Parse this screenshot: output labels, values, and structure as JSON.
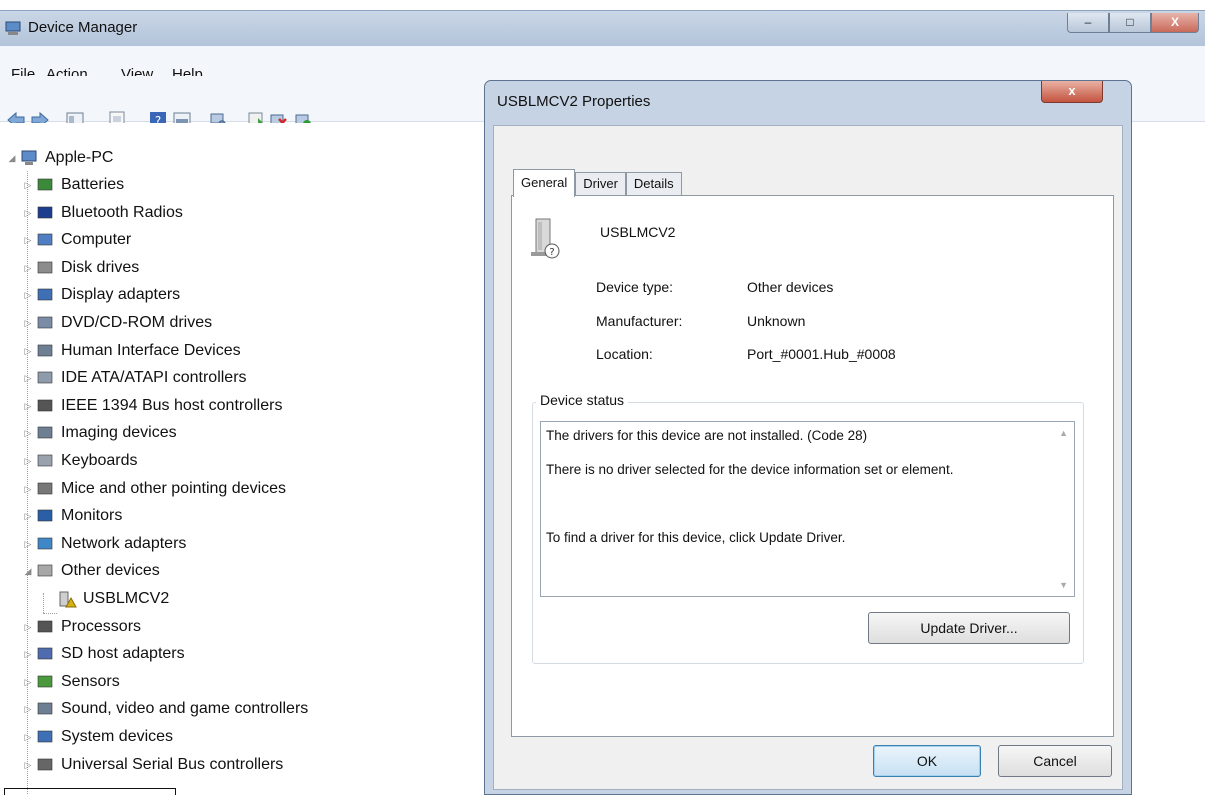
{
  "window": {
    "title": "Device Manager",
    "controls": {
      "minimize": "–",
      "maximize": "□",
      "close": "X"
    }
  },
  "menu": [
    "File",
    "Action",
    "View",
    "Help"
  ],
  "toolbar_icons": [
    "back-icon",
    "forward-icon",
    "properties-view-icon",
    "blank-page-icon",
    "help-icon",
    "view-icon",
    "scan-hardware-icon",
    "update-driver-icon",
    "uninstall-icon",
    "disable-icon"
  ],
  "tree": {
    "root": "Apple-PC",
    "categories": [
      {
        "label": "Batteries",
        "icon": "battery-icon",
        "expanded": false
      },
      {
        "label": "Bluetooth Radios",
        "icon": "bluetooth-icon",
        "expanded": false
      },
      {
        "label": "Computer",
        "icon": "computer-icon",
        "expanded": false
      },
      {
        "label": "Disk drives",
        "icon": "disk-drive-icon",
        "expanded": false
      },
      {
        "label": "Display adapters",
        "icon": "display-adapter-icon",
        "expanded": false
      },
      {
        "label": "DVD/CD-ROM drives",
        "icon": "dvd-drive-icon",
        "expanded": false
      },
      {
        "label": "Human Interface Devices",
        "icon": "hid-icon",
        "expanded": false
      },
      {
        "label": "IDE ATA/ATAPI controllers",
        "icon": "ide-controller-icon",
        "expanded": false
      },
      {
        "label": "IEEE 1394 Bus host controllers",
        "icon": "ieee1394-icon",
        "expanded": false
      },
      {
        "label": "Imaging devices",
        "icon": "imaging-device-icon",
        "expanded": false
      },
      {
        "label": "Keyboards",
        "icon": "keyboard-icon",
        "expanded": false
      },
      {
        "label": "Mice and other pointing devices",
        "icon": "mouse-icon",
        "expanded": false
      },
      {
        "label": "Monitors",
        "icon": "monitor-icon",
        "expanded": false
      },
      {
        "label": "Network adapters",
        "icon": "network-adapter-icon",
        "expanded": false
      },
      {
        "label": "Other devices",
        "icon": "unknown-device-icon",
        "expanded": true,
        "children": [
          {
            "label": "USBLMCV2",
            "icon": "warning-device-icon"
          }
        ]
      },
      {
        "label": "Processors",
        "icon": "processor-icon",
        "expanded": false
      },
      {
        "label": "SD host adapters",
        "icon": "sd-adapter-icon",
        "expanded": false
      },
      {
        "label": "Sensors",
        "icon": "sensor-icon",
        "expanded": false
      },
      {
        "label": "Sound, video and game controllers",
        "icon": "speaker-icon",
        "expanded": false
      },
      {
        "label": "System devices",
        "icon": "system-device-icon",
        "expanded": false
      },
      {
        "label": "Universal Serial Bus controllers",
        "icon": "usb-icon",
        "expanded": false
      }
    ]
  },
  "dialog": {
    "title": "USBLMCV2 Properties",
    "close": "x",
    "tabs": [
      "General",
      "Driver",
      "Details"
    ],
    "active_tab": "General",
    "device_name": "USBLMCV2",
    "properties": [
      {
        "label": "Device type:",
        "value": "Other devices"
      },
      {
        "label": "Manufacturer:",
        "value": "Unknown"
      },
      {
        "label": "Location:",
        "value": "Port_#0001.Hub_#0008"
      }
    ],
    "status_group": "Device status",
    "status_lines": [
      "The drivers for this device are not installed. (Code 28)",
      "There is no driver selected for the device information set or element.",
      "To find a driver for this device, click Update Driver."
    ],
    "update_driver": "Update Driver...",
    "ok": "OK",
    "cancel": "Cancel"
  },
  "colors": {
    "titlebar": "#b8c8dc",
    "dialog_frame": "#c6d3e4",
    "close_red": "#c3533f",
    "default_button": "#c7e1f3"
  }
}
